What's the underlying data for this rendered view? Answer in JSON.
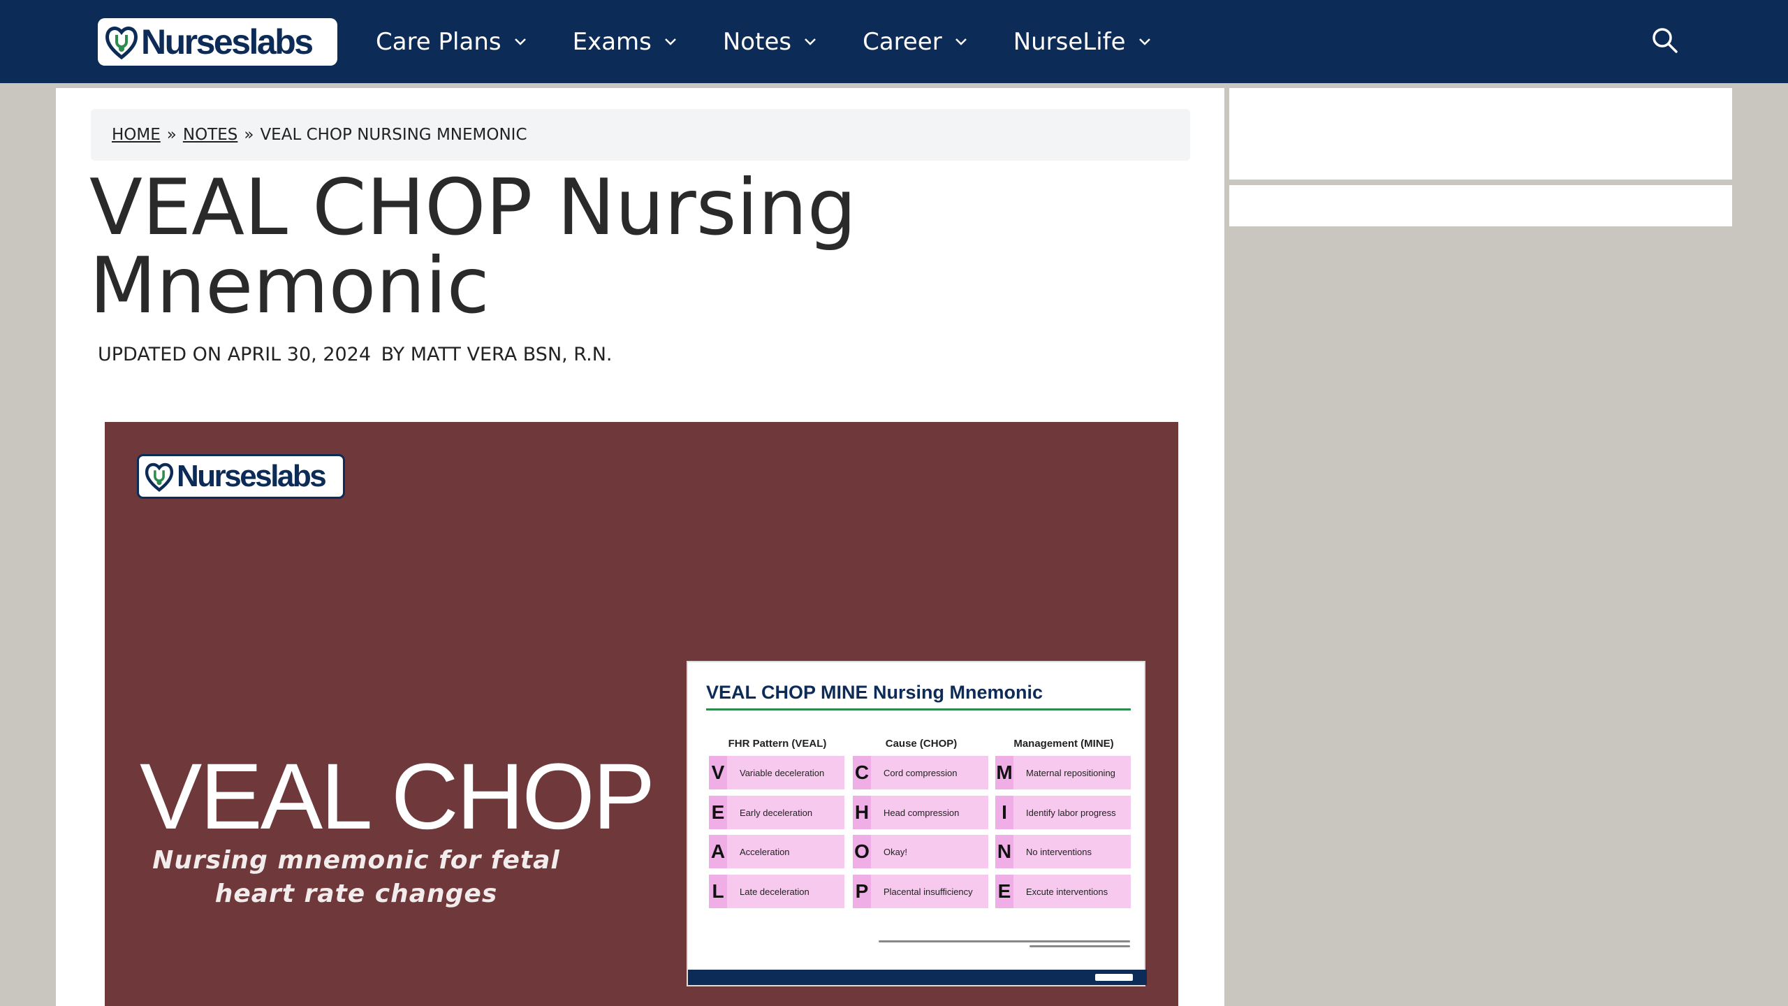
{
  "site": {
    "logo_text": "Nurseslabs"
  },
  "nav": {
    "items": [
      {
        "label": "Care Plans"
      },
      {
        "label": "Exams"
      },
      {
        "label": "Notes"
      },
      {
        "label": "Career"
      },
      {
        "label": "NurseLife"
      }
    ]
  },
  "breadcrumb": {
    "home": "HOME",
    "separator": "»",
    "notes": "NOTES",
    "current": "VEAL CHOP NURSING MNEMONIC"
  },
  "article": {
    "title": "VEAL CHOP Nursing Mnemonic",
    "updated": "UPDATED ON APRIL 30, 2024",
    "byline": "BY MATT VERA BSN, R.N."
  },
  "hero": {
    "logo_text": "Nurseslabs",
    "title": "VEAL CHOP",
    "subtitle": "Nursing mnemonic for fetal heart rate changes",
    "background": "#6f383a",
    "card": {
      "title": "VEAL CHOP MINE Nursing Mnemonic",
      "columns": [
        "FHR Pattern (VEAL)",
        "Cause (CHOP)",
        "Management (MINE)"
      ],
      "veal": [
        {
          "letter": "V",
          "text": "Variable deceleration"
        },
        {
          "letter": "E",
          "text": "Early deceleration"
        },
        {
          "letter": "A",
          "text": "Acceleration"
        },
        {
          "letter": "L",
          "text": "Late deceleration"
        }
      ],
      "chop": [
        {
          "letter": "C",
          "text": "Cord compression"
        },
        {
          "letter": "H",
          "text": "Head compression"
        },
        {
          "letter": "O",
          "text": "Okay!"
        },
        {
          "letter": "P",
          "text": "Placental insufficiency"
        }
      ],
      "mine": [
        {
          "letter": "M",
          "text": "Maternal repositioning"
        },
        {
          "letter": "I",
          "text": "Identify labor progress"
        },
        {
          "letter": "N",
          "text": "No interventions"
        },
        {
          "letter": "E",
          "text": "Excute interventions"
        }
      ]
    }
  },
  "colors": {
    "header": "#0d2b57",
    "accent_green": "#2e8b4e",
    "cell_pink": "#f7c9ef"
  },
  "icons": {
    "logo": "heart-stethoscope-icon",
    "nav_dropdown": "chevron-down-icon",
    "search": "search-icon"
  }
}
